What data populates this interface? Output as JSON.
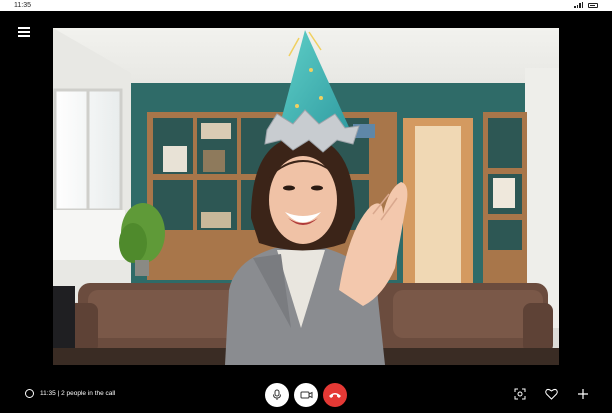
{
  "status_bar": {
    "time": "11:35"
  },
  "call": {
    "info_text": "11:35 | 2 people in the call"
  },
  "icons": {
    "menu": "hamburger-menu-icon",
    "chat": "chat-bubble-icon",
    "mic": "microphone-icon",
    "camera": "video-camera-icon",
    "end_call": "phone-hangup-icon",
    "screenshot": "capture-icon",
    "like": "heart-icon",
    "add": "plus-icon"
  },
  "colors": {
    "end_call": "#e53935",
    "background": "#000000",
    "controls": "#ffffff"
  }
}
